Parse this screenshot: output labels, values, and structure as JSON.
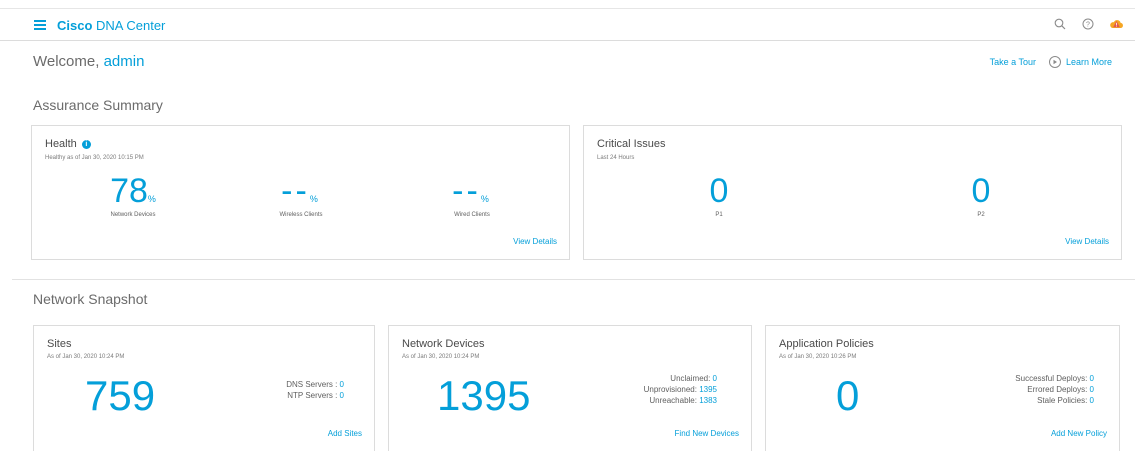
{
  "header": {
    "brand_bold": "Cisco",
    "brand_rest": " DNA Center",
    "icons": [
      "menu-icon",
      "search-icon",
      "help-icon",
      "cloud-alert-icon"
    ]
  },
  "welcome": {
    "prefix": "Welcome, ",
    "user": "admin"
  },
  "links": {
    "tour": "Take a Tour",
    "learn_more": "Learn More"
  },
  "assurance": {
    "title": "Assurance Summary",
    "health": {
      "title": "Health",
      "subtitle": "Healthy as of Jan 30, 2020 10:15 PM",
      "metrics": [
        {
          "value": "78",
          "unit": "%",
          "label": "Network Devices"
        },
        {
          "value": "--",
          "unit": "%",
          "label": "Wireless Clients"
        },
        {
          "value": "--",
          "unit": "%",
          "label": "Wired Clients"
        }
      ],
      "link": "View Details"
    },
    "critical": {
      "title": "Critical Issues",
      "subtitle": "Last 24 Hours",
      "metrics": [
        {
          "value": "0",
          "label": "P1"
        },
        {
          "value": "0",
          "label": "P2"
        }
      ],
      "link": "View Details"
    }
  },
  "snapshot": {
    "title": "Network Snapshot",
    "sites": {
      "title": "Sites",
      "subtitle": "As of Jan 30, 2020 10:24 PM",
      "count": "759",
      "details": [
        {
          "label": "DNS Servers : ",
          "value": "0"
        },
        {
          "label": "NTP Servers : ",
          "value": "0"
        }
      ],
      "link": "Add Sites"
    },
    "devices": {
      "title": "Network Devices",
      "subtitle": "As of Jan 30, 2020 10:24 PM",
      "count": "1395",
      "details": [
        {
          "label": "Unclaimed: ",
          "value": "0"
        },
        {
          "label": "Unprovisioned: ",
          "value": "1395"
        },
        {
          "label": "Unreachable: ",
          "value": "1383"
        }
      ],
      "link": "Find New Devices"
    },
    "policies": {
      "title": "Application Policies",
      "subtitle": "As of Jan 30, 2020 10:26 PM",
      "count": "0",
      "details": [
        {
          "label": "Successful Deploys: ",
          "value": "0"
        },
        {
          "label": "Errored Deploys: ",
          "value": "0"
        },
        {
          "label": "Stale Policies: ",
          "value": "0"
        }
      ],
      "link": "Add New Policy"
    }
  },
  "colors": {
    "accent": "#049fd9",
    "warning": "#f5a623"
  }
}
